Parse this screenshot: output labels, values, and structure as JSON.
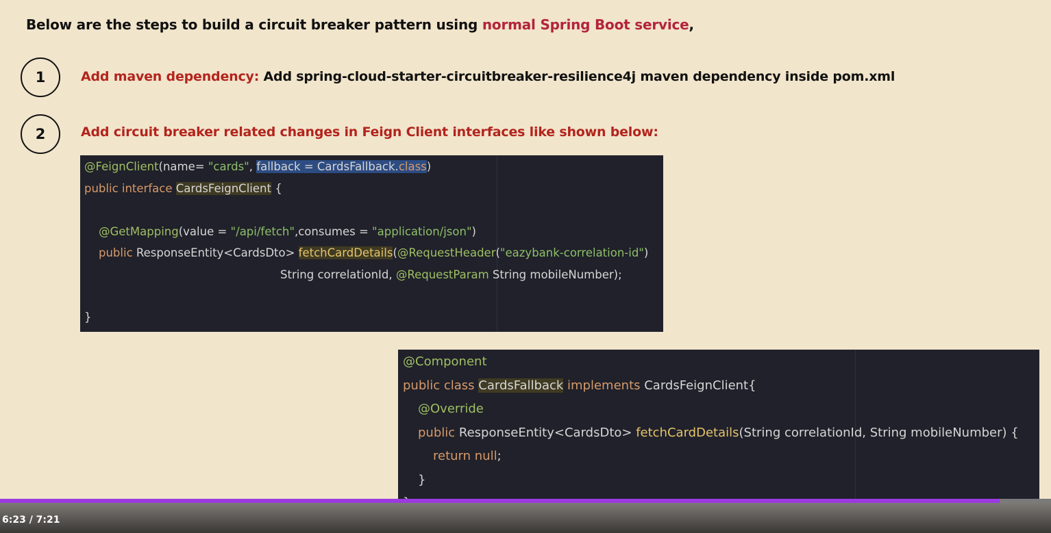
{
  "heading": {
    "prefix": "Below are the steps to build a circuit breaker pattern using ",
    "accent": "normal Spring Boot service",
    "suffix": ","
  },
  "steps": [
    {
      "number": "1",
      "title": "Add maven dependency:",
      "text": " Add spring-cloud-starter-circuitbreaker-resilience4j maven dependency inside pom.xml"
    },
    {
      "number": "2",
      "title": "Add circuit breaker related changes in Feign Client interfaces like shown below:"
    }
  ],
  "code_feign": {
    "l1": {
      "ann": "@FeignClient",
      "p1": "(name= ",
      "s1": "\"cards\"",
      "p2": ", ",
      "sel_a": "fallback = CardsFallback.",
      "sel_kw": "class",
      "p3": ")"
    },
    "l2": {
      "kw": "public interface ",
      "ident": "CardsFeignClient",
      "p1": " {"
    },
    "l3": {
      "ann": "@GetMapping",
      "p1": "(value = ",
      "s1": "\"/api/fetch\"",
      "p2": ",consumes = ",
      "s2": "\"application/json\"",
      "p3": ")"
    },
    "l4": {
      "kw": "public ",
      "p1": "ResponseEntity<CardsDto> ",
      "fn": "fetchCardDetails",
      "p2": "(",
      "ann": "@RequestHeader",
      "p3": "(",
      "s1": "\"eazybank-correlation-id\"",
      "p4": ")"
    },
    "l5": {
      "p1": "String correlationId, ",
      "ann": "@RequestParam",
      "p2": " String mobileNumber);"
    },
    "l6": {
      "p1": "}"
    }
  },
  "code_fallback": {
    "l1": {
      "ann": "@Component"
    },
    "l2": {
      "kw": "public class ",
      "ident": "CardsFallback",
      "kw2": " implements ",
      "p1": "CardsFeignClient{"
    },
    "l3": {
      "ann": "@Override"
    },
    "l4": {
      "kw": "public ",
      "p1": "ResponseEntity<CardsDto> ",
      "fn": "fetchCardDetails",
      "p2": "(String correlationId, String mobileNumber) {"
    },
    "l5": {
      "kw": "return null",
      "p1": ";"
    },
    "l6": {
      "p1": "}"
    },
    "l7": {
      "p1": "}"
    }
  },
  "player": {
    "time": "6:23 / 7:21",
    "progress": 0.951,
    "accent_color": "#9b3ae0"
  }
}
